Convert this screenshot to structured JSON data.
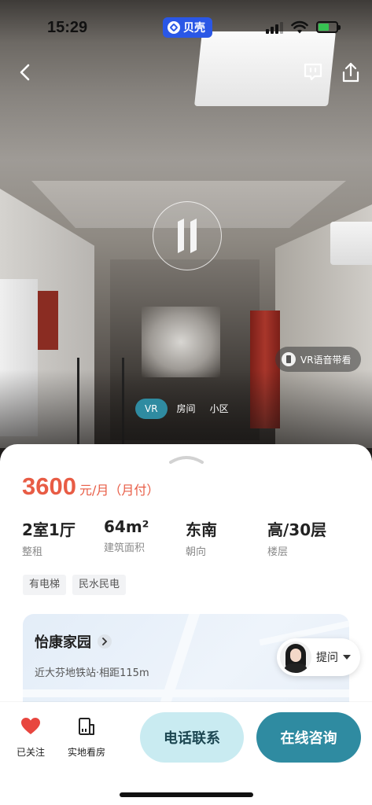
{
  "status_bar": {
    "time": "15:29",
    "app_badge": "贝壳"
  },
  "viewer": {
    "vr_voice_label": "VR语音带看",
    "view_tabs": [
      {
        "label": "VR",
        "active": true
      },
      {
        "label": "房间",
        "active": false
      },
      {
        "label": "小区",
        "active": false
      }
    ],
    "icons": [
      "back-icon",
      "message-icon",
      "share-icon",
      "pause-icon"
    ]
  },
  "listing": {
    "price": "3600",
    "price_unit": "元/月（月付）",
    "specs": [
      {
        "value": "2室1厅",
        "label": "整租"
      },
      {
        "value": "64m²",
        "label": "建筑面积"
      },
      {
        "value": "东南",
        "label": "朝向"
      },
      {
        "value": "高/30层",
        "label": "楼层"
      }
    ],
    "tags": [
      "有电梯",
      "民水民电"
    ]
  },
  "community": {
    "name": "怡康家园",
    "distance": "近大芬地铁站·相距115m"
  },
  "ask": {
    "label": "提问"
  },
  "actions": {
    "follow_label": "已关注",
    "visit_label": "实地看房",
    "call_label": "电话联系",
    "chat_label": "在线咨询"
  },
  "colors": {
    "price": "#e85c45",
    "primary": "#2f8ba1",
    "call_bg": "#c9ebf1",
    "heart": "#e8463f",
    "app_badge": "#2a57e6"
  }
}
